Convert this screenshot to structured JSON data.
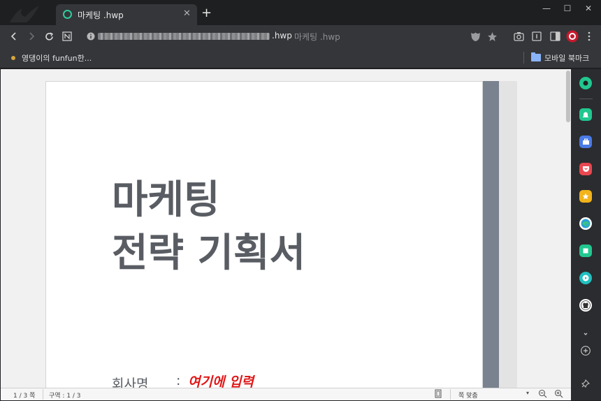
{
  "window": {
    "minimize": "—",
    "maximize": "☐",
    "close": "✕"
  },
  "tab": {
    "title": "마케팅 .hwp",
    "close": "✕",
    "new_tab": "+"
  },
  "address_bar": {
    "file_ext": ".hwp",
    "page_title": "마케팅 .hwp"
  },
  "bookmarks": {
    "item_label": "영댕이의 funfun한...",
    "folder_label": "모바일 북마크"
  },
  "document": {
    "title_line1": "마케팅",
    "title_line2": "전략  기획서",
    "company_label": "회사명",
    "company_colon": ":",
    "company_value": "여기에  입력"
  },
  "statusbar": {
    "page": "1 / 3 쪽",
    "section": "구역 : 1 / 3",
    "zoom": "쪽 맞춤",
    "zoom_arrow": "▾"
  },
  "colors": {
    "accent": "#2ecc9a",
    "title_gray": "#595d63",
    "input_red": "#e01818",
    "side_band": "#7a8290"
  }
}
